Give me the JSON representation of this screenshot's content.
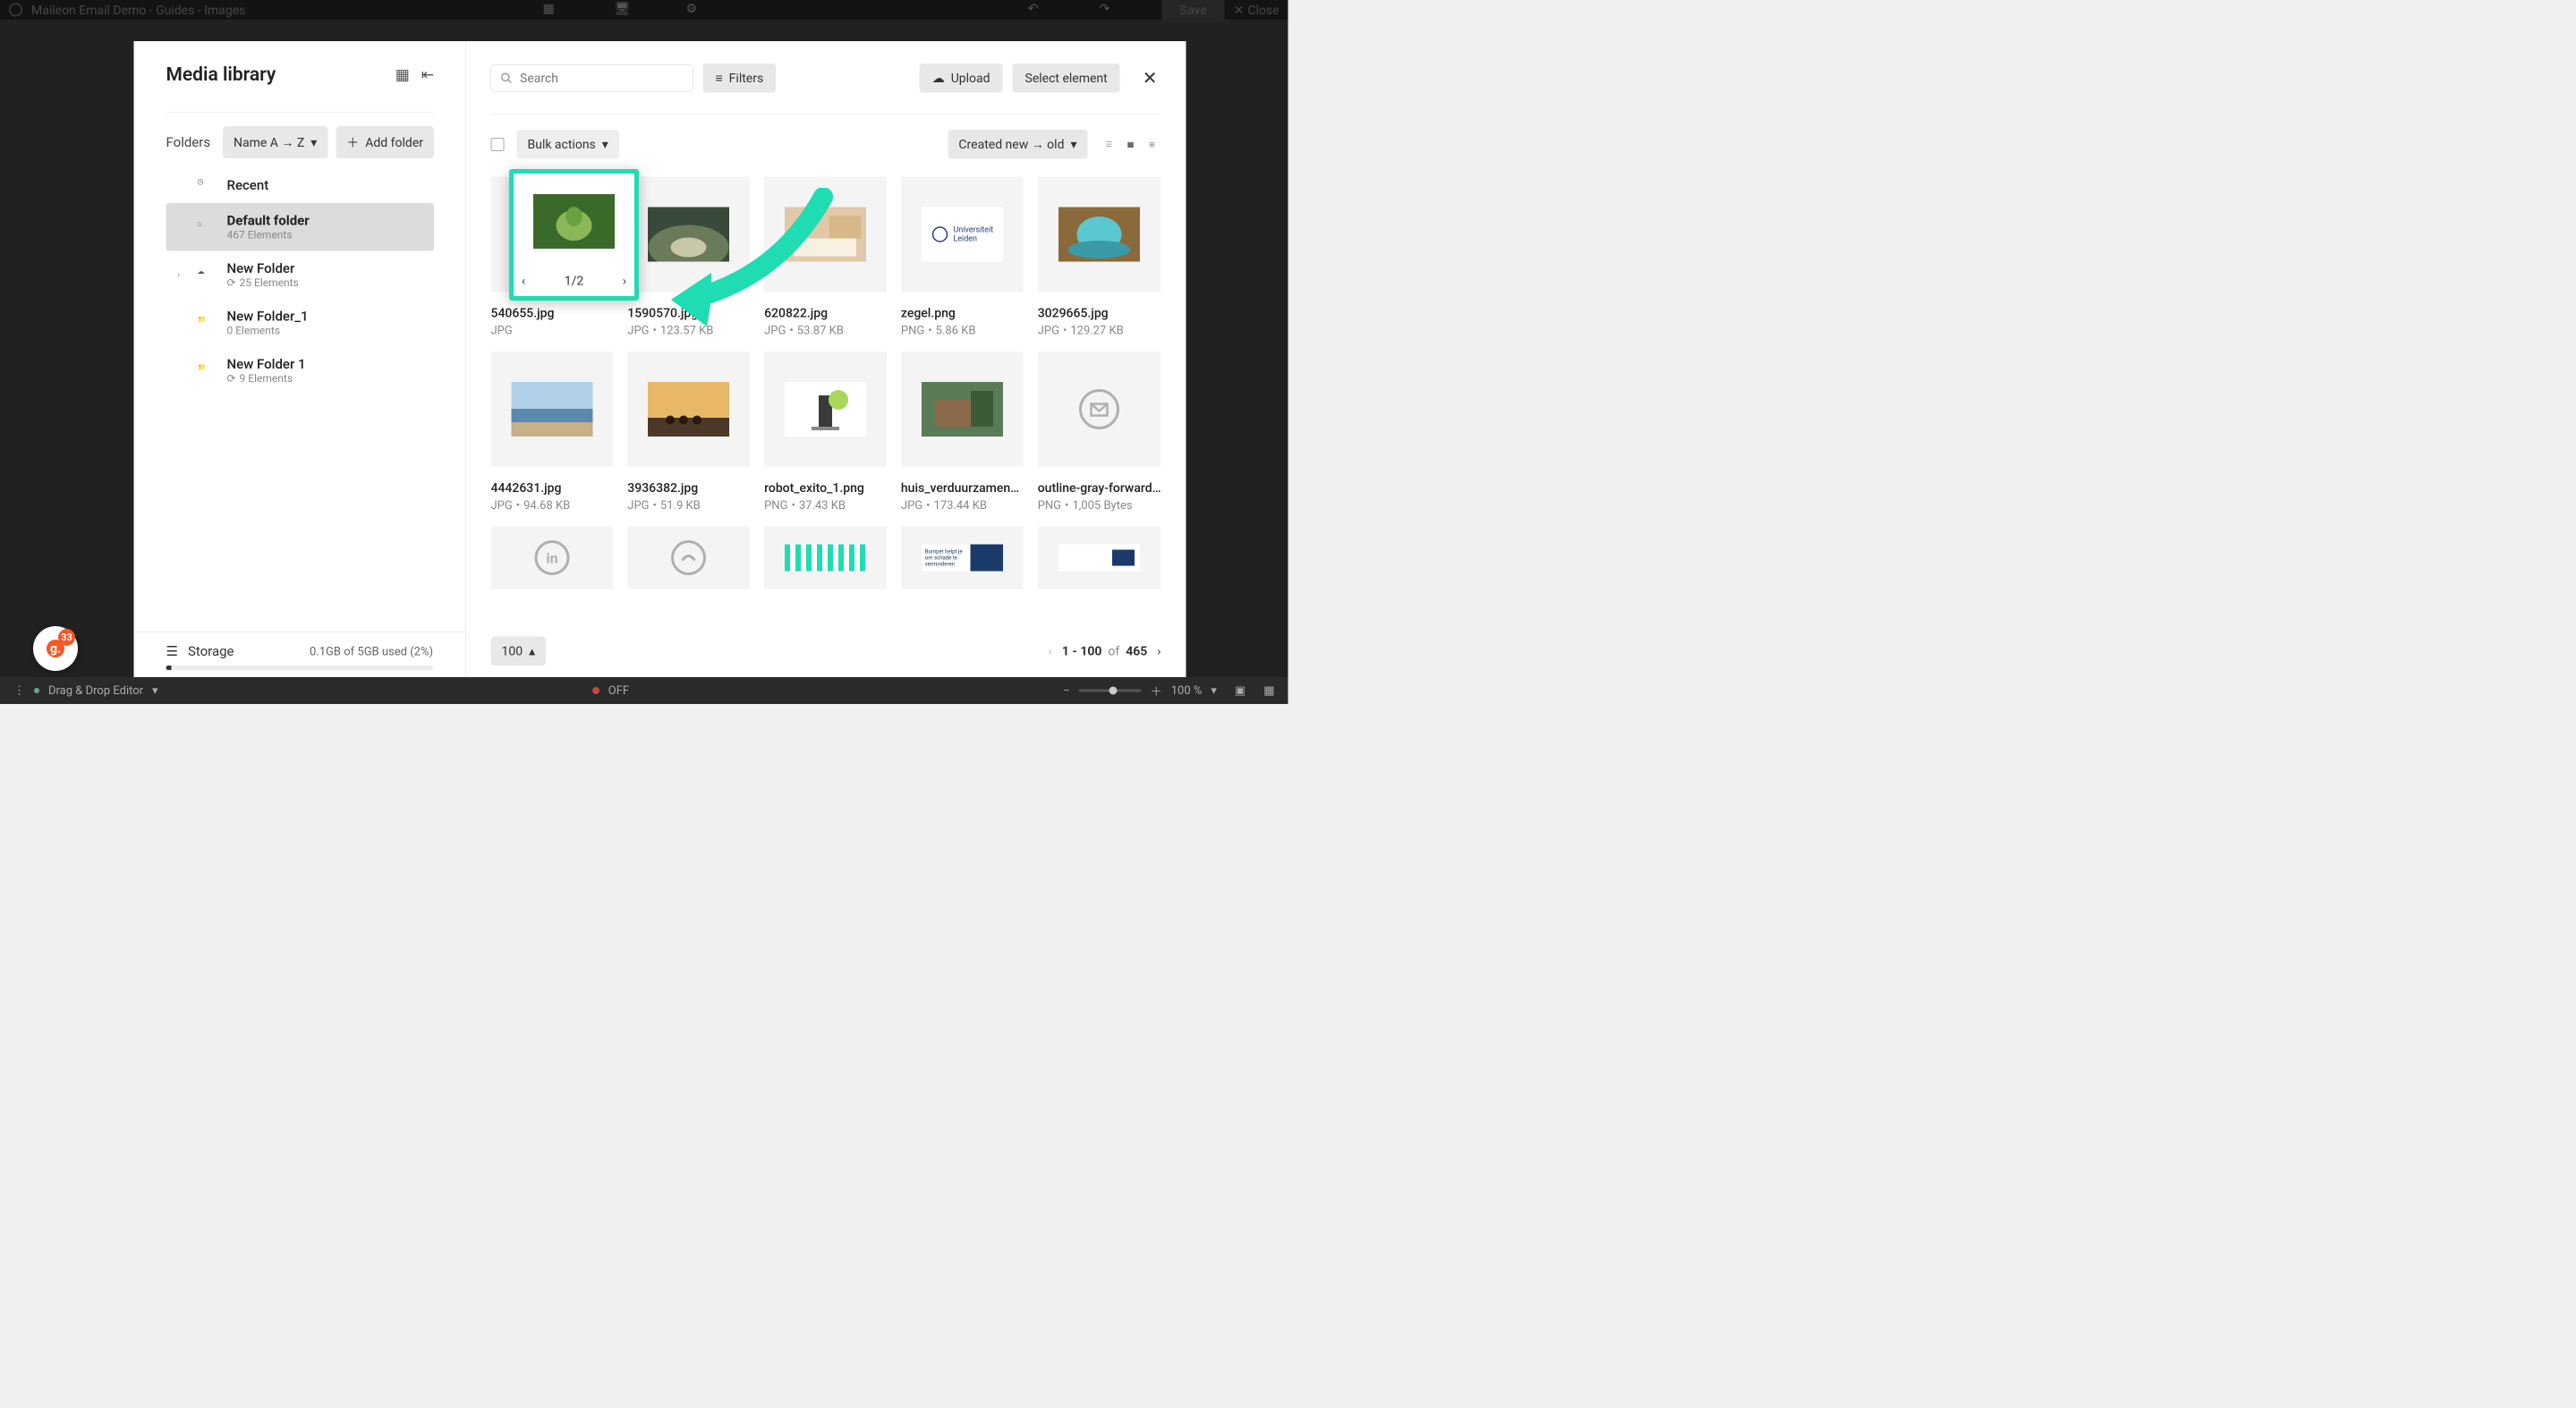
{
  "app": {
    "title": "Maileon Email Demo - Guides - Images",
    "save_label": "Save",
    "close_label": "Close",
    "settings_label": "Settings",
    "editor_label": "Drag & Drop Editor",
    "zoom": "100 %",
    "off_label": "OFF",
    "badge_count": "33"
  },
  "modal": {
    "title": "Media library",
    "folders_label": "Folders",
    "sort": "Name A → Z",
    "add_folder": "Add folder",
    "search_placeholder": "Search",
    "filters": "Filters",
    "upload": "Upload",
    "select_element": "Select element",
    "bulk_actions": "Bulk actions",
    "sort_files": "Created new → old",
    "page_size": "100",
    "pagination_range": "1 - 100",
    "pagination_of": "of",
    "pagination_total": "465",
    "storage_label": "Storage",
    "storage_detail": "0.1GB of 5GB used (2%)"
  },
  "highlight": {
    "page": "1/2"
  },
  "folders": [
    {
      "name": "Recent",
      "sub": "",
      "icon": "clock"
    },
    {
      "name": "Default folder",
      "sub": "467 Elements",
      "icon": "home",
      "active": true,
      "bold": true
    },
    {
      "name": "New Folder",
      "sub": "25 Elements",
      "icon": "cloud",
      "expandable": true,
      "shared": true
    },
    {
      "name": "New Folder_1",
      "sub": "0 Elements",
      "icon": "folder"
    },
    {
      "name": "New Folder 1",
      "sub": "9 Elements",
      "icon": "folder",
      "shared": true
    }
  ],
  "files": [
    {
      "name": "540655.jpg",
      "type": "JPG",
      "size": ""
    },
    {
      "name": "1590570.jpg",
      "type": "JPG",
      "size": "123.57 KB"
    },
    {
      "name": "620822.jpg",
      "type": "JPG",
      "size": "53.87 KB"
    },
    {
      "name": "zegel.png",
      "type": "PNG",
      "size": "5.86 KB"
    },
    {
      "name": "3029665.jpg",
      "type": "JPG",
      "size": "129.27 KB"
    },
    {
      "name": "4442631.jpg",
      "type": "JPG",
      "size": "94.68 KB"
    },
    {
      "name": "3936382.jpg",
      "type": "JPG",
      "size": "51.9 KB"
    },
    {
      "name": "robot_exito_1.png",
      "type": "PNG",
      "size": "37.43 KB"
    },
    {
      "name": "huis_verduurzamen…",
      "type": "JPG",
      "size": "173.44 KB"
    },
    {
      "name": "outline-gray-forward…",
      "type": "PNG",
      "size": "1,005 Bytes"
    }
  ]
}
